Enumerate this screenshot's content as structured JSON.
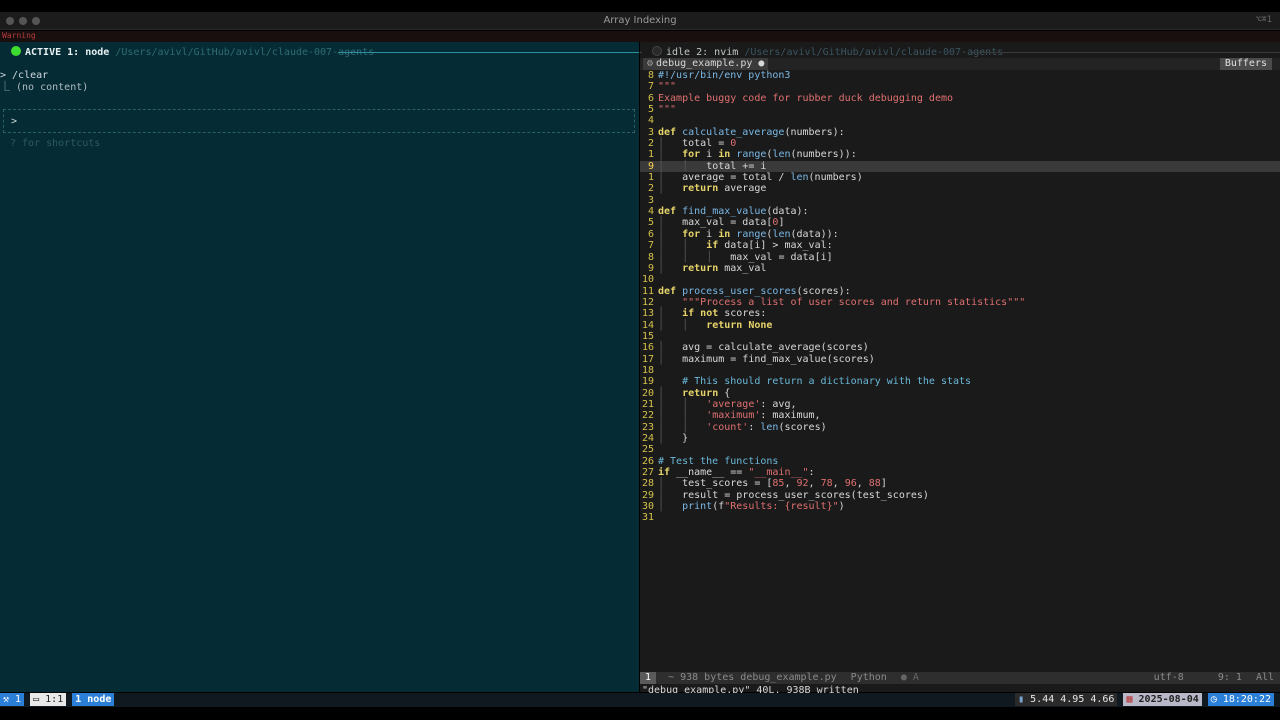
{
  "window": {
    "title": "Array Indexing",
    "shortcut": "⌥⌘1",
    "top_banner": "Warning"
  },
  "left_pane": {
    "status": "ACTIVE",
    "index": "1: node",
    "path": "/Users/avivl/GitHub/avivl/claude-007-agents",
    "lines": [
      "> /clear",
      "  ⎿  (no content)"
    ],
    "prompt": ">",
    "hint": "? for shortcuts"
  },
  "right_pane": {
    "status": "idle",
    "index": "2: nvim",
    "path": "/Users/avivl/GitHub/avivl/claude-007-agents",
    "buffer_tab": "debug_example.py",
    "buffer_modified": "●",
    "buffers_label": "Buffers",
    "code_lines": [
      {
        "n": "8",
        "t": "#!/usr/bin/env python3",
        "c": "sh"
      },
      {
        "n": "7",
        "t": "\"\"\"",
        "c": "st"
      },
      {
        "n": "6",
        "t": "Example buggy code for rubber duck debugging demo",
        "c": "st"
      },
      {
        "n": "5",
        "t": "\"\"\"",
        "c": "st"
      },
      {
        "n": "4",
        "t": "",
        "c": "tx"
      },
      {
        "n": "3",
        "t": "def calculate_average(numbers):",
        "c": "def"
      },
      {
        "n": "2",
        "t": "    total = 0",
        "c": "tx"
      },
      {
        "n": "1",
        "t": "    for i in range(len(numbers)):",
        "c": "tx"
      },
      {
        "n": "9",
        "t": "        total += i",
        "c": "tx",
        "cur": true
      },
      {
        "n": "1",
        "t": "    average = total / len(numbers)",
        "c": "tx"
      },
      {
        "n": "2",
        "t": "    return average",
        "c": "tx"
      },
      {
        "n": "3",
        "t": "",
        "c": "tx"
      },
      {
        "n": "4",
        "t": "def find_max_value(data):",
        "c": "def"
      },
      {
        "n": "5",
        "t": "    max_val = data[0]",
        "c": "tx"
      },
      {
        "n": "6",
        "t": "    for i in range(len(data)):",
        "c": "tx"
      },
      {
        "n": "7",
        "t": "        if data[i] > max_val:",
        "c": "tx"
      },
      {
        "n": "8",
        "t": "            max_val = data[i]",
        "c": "tx"
      },
      {
        "n": "9",
        "t": "    return max_val",
        "c": "tx"
      },
      {
        "n": "10",
        "t": "",
        "c": "tx"
      },
      {
        "n": "11",
        "t": "def process_user_scores(scores):",
        "c": "def"
      },
      {
        "n": "12",
        "t": "    \"\"\"Process a list of user scores and return statistics\"\"\"",
        "c": "st"
      },
      {
        "n": "13",
        "t": "    if not scores:",
        "c": "tx"
      },
      {
        "n": "14",
        "t": "        return None",
        "c": "tx"
      },
      {
        "n": "15",
        "t": "",
        "c": "tx"
      },
      {
        "n": "16",
        "t": "    avg = calculate_average(scores)",
        "c": "tx"
      },
      {
        "n": "17",
        "t": "    maximum = find_max_value(scores)",
        "c": "tx"
      },
      {
        "n": "18",
        "t": "",
        "c": "tx"
      },
      {
        "n": "19",
        "t": "    # This should return a dictionary with the stats",
        "c": "cm"
      },
      {
        "n": "20",
        "t": "    return {",
        "c": "tx"
      },
      {
        "n": "21",
        "t": "        'average': avg,",
        "c": "tx"
      },
      {
        "n": "22",
        "t": "        'maximum': maximum,",
        "c": "tx"
      },
      {
        "n": "23",
        "t": "        'count': len(scores)",
        "c": "tx"
      },
      {
        "n": "24",
        "t": "    }",
        "c": "tx"
      },
      {
        "n": "25",
        "t": "",
        "c": "tx"
      },
      {
        "n": "26",
        "t": "# Test the functions",
        "c": "cm"
      },
      {
        "n": "27",
        "t": "if __name__ == \"__main__\":",
        "c": "tx"
      },
      {
        "n": "28",
        "t": "    test_scores = [85, 92, 78, 96, 88]",
        "c": "tx"
      },
      {
        "n": "29",
        "t": "    result = process_user_scores(test_scores)",
        "c": "tx"
      },
      {
        "n": "30",
        "t": "    print(f\"Results: {result}\")",
        "c": "tx"
      },
      {
        "n": "31",
        "t": "",
        "c": "tx"
      }
    ],
    "statusline": {
      "mode": "1",
      "file_info": "~ 938 bytes debug_example.py",
      "filetype": "Python",
      "diag": "● A",
      "encoding": "utf-8",
      "position": "9:  1",
      "scroll": "All"
    },
    "command_line": "\"debug_example.py\" 40L, 938B written"
  },
  "tmux": {
    "session": "1",
    "window_pos": "1:1",
    "active_window": "1 node",
    "load": "5.44 4.95 4.66",
    "date": "2025-08-04",
    "time": "18:20:22"
  },
  "colors": {
    "left_bg": "#052b35",
    "right_bg": "#1a1a1a",
    "accent": "#2c7fd6",
    "active_dot": "#3ddc2f"
  }
}
